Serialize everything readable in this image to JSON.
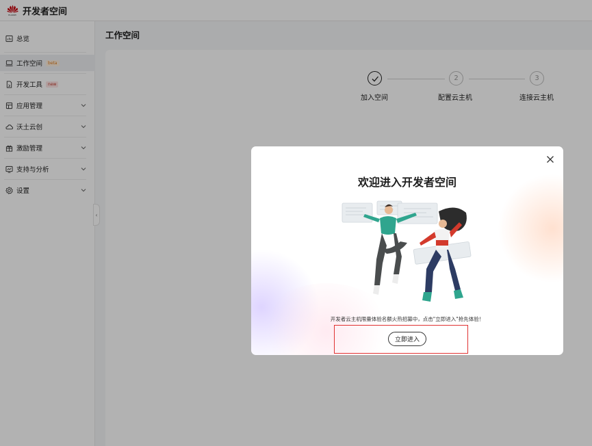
{
  "header": {
    "logo_text": "HUAWEI",
    "app_title": "开发者空间",
    "brand_color": "#c7000b"
  },
  "sidebar": {
    "items": [
      {
        "label": "总览",
        "icon": "overview-icon"
      },
      {
        "label": "工作空间",
        "icon": "workspace-icon",
        "tag": "beta",
        "active": true
      },
      {
        "label": "开发工具",
        "icon": "devtools-icon",
        "tag": "new"
      },
      {
        "label": "应用管理",
        "icon": "app-management-icon",
        "expandable": true
      },
      {
        "label": "沃土云创",
        "icon": "cloud-icon",
        "expandable": true
      },
      {
        "label": "激励管理",
        "icon": "gift-icon",
        "expandable": true
      },
      {
        "label": "支持与分析",
        "icon": "analytics-icon",
        "expandable": true
      },
      {
        "label": "设置",
        "icon": "gear-icon",
        "expandable": true
      }
    ],
    "collapse_glyph": "‹"
  },
  "main": {
    "page_title": "工作空间",
    "steps": [
      {
        "label": "加入空间",
        "number": "",
        "done": true
      },
      {
        "label": "配置云主机",
        "number": "2",
        "done": false
      },
      {
        "label": "连接云主机",
        "number": "3",
        "done": false
      }
    ]
  },
  "modal": {
    "title": "欢迎进入开发者空间",
    "description": "开发者云主机限量体验名额火热招募中，点击\"立即进入\"抢先体验！",
    "enter_button": "立即进入",
    "close_icon": "close-icon"
  }
}
